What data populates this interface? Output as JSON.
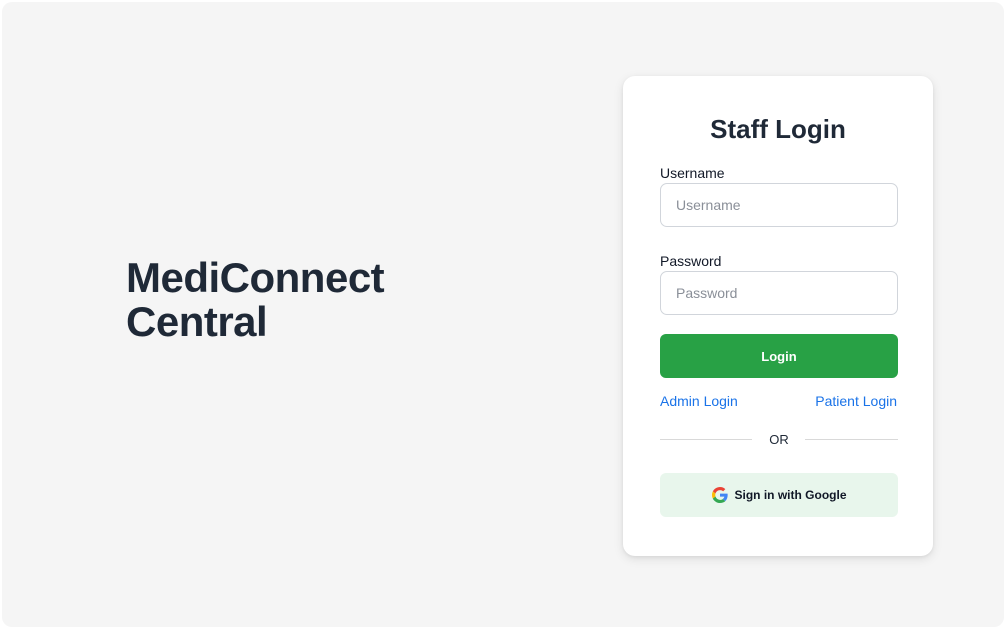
{
  "brand": {
    "line1": "MediConnect",
    "line2": "Central"
  },
  "login_card": {
    "title": "Staff Login",
    "username": {
      "label": "Username",
      "placeholder": "Username",
      "value": ""
    },
    "password": {
      "label": "Password",
      "placeholder": "Password",
      "value": ""
    },
    "login_button": "Login",
    "admin_link": "Admin Login",
    "patient_link": "Patient Login",
    "divider": "OR",
    "google_button": "Sign in with Google",
    "google_icon": "google-g-icon"
  },
  "colors": {
    "page_background": "#f5f5f5",
    "card_background": "#ffffff",
    "primary_button": "#28a145",
    "link": "#1a73e8",
    "google_button_background": "#e8f6ec",
    "heading_text": "#1f2937"
  }
}
